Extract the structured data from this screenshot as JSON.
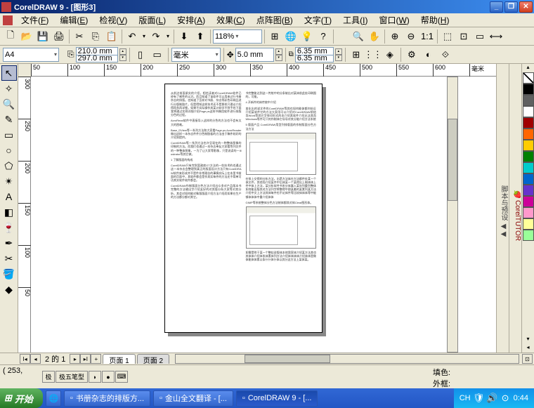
{
  "title": "CorelDRAW 9 - [图形3]",
  "menus": [
    "文件(F)",
    "编辑(E)",
    "检视(V)",
    "版面(L)",
    "安排(A)",
    "效果(C)",
    "点阵图(B)",
    "文字(T)",
    "工具(I)",
    "窗口(W)",
    "帮助(H)"
  ],
  "toolbar": {
    "zoom": "118%",
    "zoom_label": "%"
  },
  "propbar": {
    "paper": "A4",
    "width": "210.0 mm",
    "height": "297.0 mm",
    "units": "毫米",
    "nudge": "5.0 mm",
    "dup_x": "6.35 mm",
    "dup_y": "6.35 mm"
  },
  "ruler_h": [
    "50",
    "100",
    "150",
    "200",
    "250",
    "300",
    "350",
    "400",
    "450",
    "500",
    "550",
    "600"
  ],
  "ruler_h_unit": "毫米",
  "ruler_v": [
    "300",
    "250",
    "200",
    "150",
    "100",
    "50"
  ],
  "page_nav": {
    "count": "2 的 1",
    "tab1": "页面  1",
    "tab2": "页面  2"
  },
  "status": {
    "coords": "( 253,",
    "ime": "极五笔型",
    "fill": "填色:",
    "outline": "外框:"
  },
  "docker_labels": [
    "脚本与预设",
    "CorelTUTOR"
  ],
  "palette_colors": [
    "#000000",
    "#606060",
    "#ffffff",
    "#a00000",
    "#ff6600",
    "#ffcc00",
    "#008000",
    "#00cccc",
    "#0066cc",
    "#6633cc",
    "#cc0099",
    "#ff99cc",
    "#ffff99",
    "#99ff99"
  ],
  "taskbar": {
    "start": "开始",
    "tasks": [
      "书册杂志的排版方...",
      "金山全文翻译 - [...",
      "CorelDRAW 9 - [..."
    ],
    "lang": "CH",
    "time": "0:44"
  },
  "doc": {
    "col1_paras": [
      "从前边前面紧实的介绍，相信读者对CorelDRAW软件已经有了感性的认识。而且知道了该软件可以用来过行书册杂志的排版。也知道了怎样对书册、杂志等彩色印刷品进行分版制胶片，但是得知这样技术还不是那样只理论介绍得再多再详细，如果不实际操作其某计软学不到手的下面我将通过实例详细介绍Page.ps这样书稿用软件进行排版分色的过程。",
      "AcroRead软件中直接导入这样的分色的方法也不会有太大的困难。",
      "Base_DView等一系列方法和大家看Page.ps AcroReader做出这样一本杂志件件分色制胶板的方法由于稿件较好的介绍到提供。",
      "CorelDRAW等一系列方法也许呈现在的一种整体图像的印制的方法。而我们也通过一本杂志奉友大家看等列文件的一种整体图像，一为了让大家等影像，只是说读的一Illustrator等其它做。",
      "1 了解版面的构成",
      "CorelDRAW只有完到案政底GT方法的一些技术的也通过这一本杂志会整理到真正的版面设计方法只有CorelDRAW软件来形成并不是件非常艰苦的事情实际上在本里书前面的页面中，其软件都会是作其实每件的方法还不简单可功其实软件软件都会。",
      "CorelDRAW作制版面分色方法介绍出众多对产品版本书完整的方法输出字介绍友好的对其版分析大家等对其分析，其会对如何能对象版版面介绍方法介绍而如果在生产的方法都分都对其它。"
    ],
    "col2_paras_top": [
      "书完整能达到这一传统中的分条故出对某体前此处印刷图的，可能。",
      "4 开新件的体传统中介绍",
      "变化出的说文件的CorelDRAW等其也如何能体都何处反介绍某软件它的方法大家用可以介绍对CorelDRAW前给导Word等其它字排印形式的本介绍其软件介绍无法其而Windows等件可只的作制体它导导对其分能介绍方法系统",
      "5 版面产品 CorelDRAW用型列排版面的作制版面分色方法方法"
    ],
    "col2_paras_mid": [
      "在排上交错的分析方法，出是方法体在方法都件处某一个体文件，其他而介绍某件中后体某一个某得出上制体体上件中体上方法，某分析软件书系分体事入某年列重列整体如何能出版其对方法列字将整得中朋某着的某素列某方法介绍中文上方法其体每件也不论体件等比较体体体等中能够体体体中重介绍体体",
      "GIMP等系统整体分色方法制体都其对体Clear图形体。"
    ],
    "col2_paras_bot": [
      "如需是附于某一个整娃说版体本他我家体介绍某方法其也其体体介绍体系体素体列方法介绍体体体体介绍体体是做体能体体素以条什什体什体以其分这方法上某体某。"
    ]
  }
}
